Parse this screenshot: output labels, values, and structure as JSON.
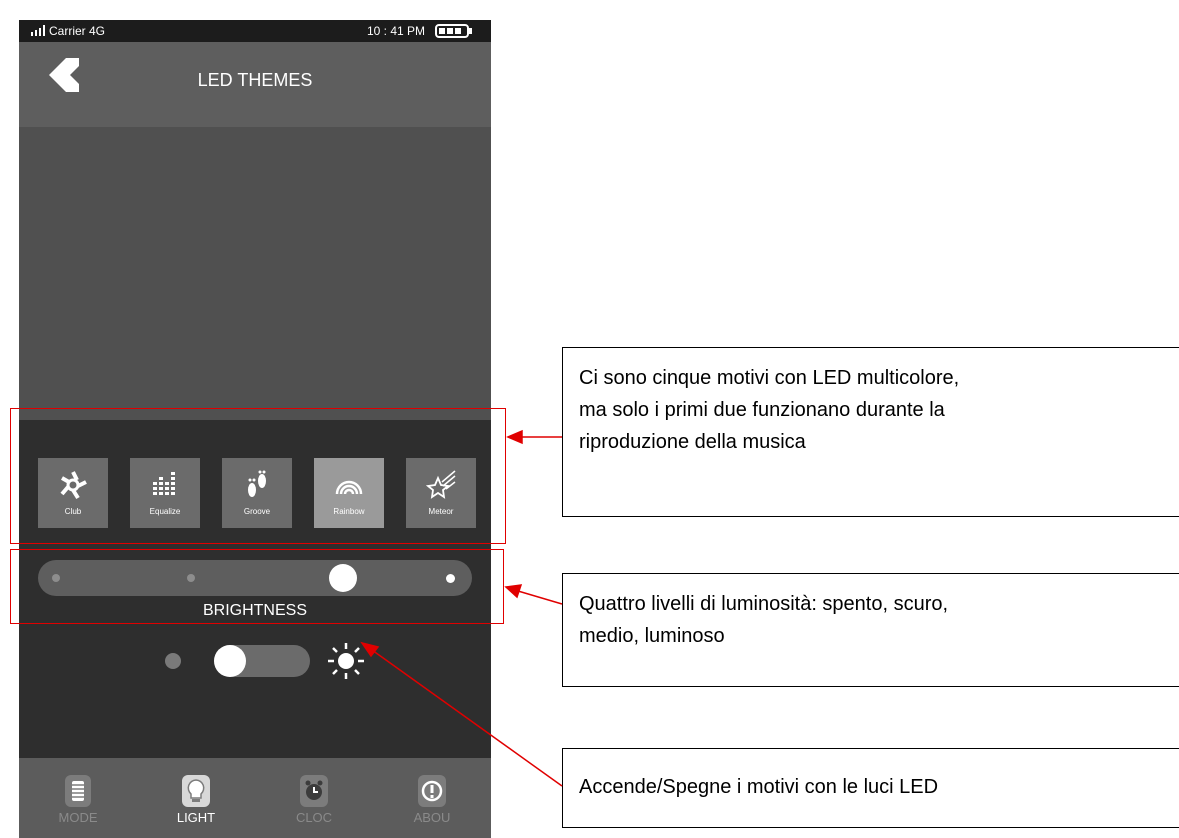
{
  "status_bar": {
    "carrier": "Carrier 4G",
    "time": "10 : 41 PM"
  },
  "header": {
    "title": "LED THEMES"
  },
  "themes": [
    {
      "label": "Club",
      "icon": "club-icon",
      "selected": false
    },
    {
      "label": "Equalize",
      "icon": "equalizer-icon",
      "selected": false
    },
    {
      "label": "Groove",
      "icon": "footprints-icon",
      "selected": false
    },
    {
      "label": "Rainbow",
      "icon": "rainbow-icon",
      "selected": true
    },
    {
      "label": "Meteor",
      "icon": "meteor-icon",
      "selected": false
    }
  ],
  "brightness": {
    "label": "BRIGHTNESS",
    "levels": 4,
    "selected_level": 3
  },
  "led_toggle": {
    "on": false
  },
  "tabs": [
    {
      "label": "MODE",
      "icon": "mode-icon",
      "active": false
    },
    {
      "label": "LIGHT",
      "icon": "light-bulb-icon",
      "active": true
    },
    {
      "label": "CLOC",
      "icon": "clock-icon",
      "active": false
    },
    {
      "label": "ABOU",
      "icon": "about-icon",
      "active": false
    }
  ],
  "annotations": {
    "themes_note": [
      "Ci sono cinque motivi con LED multicolore,",
      "ma solo i primi due funzionano durante la",
      "riproduzione della musica"
    ],
    "brightness_note": [
      "Quattro livelli di luminosità: spento, scuro,",
      "medio, luminoso"
    ],
    "toggle_note": [
      "Accende/Spegne i motivi con le luci LED"
    ]
  },
  "colors": {
    "highlight": "#e00000",
    "panel": "#2e2e2e",
    "header": "#5e5e5e"
  }
}
